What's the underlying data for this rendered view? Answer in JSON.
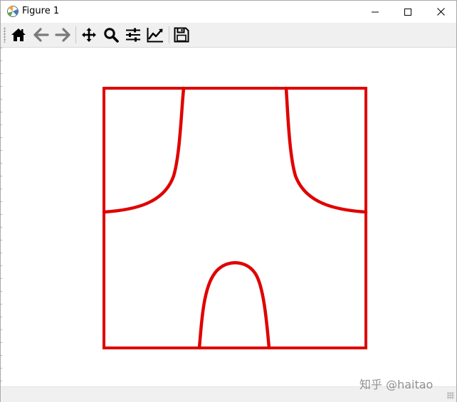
{
  "window": {
    "title": "Figure 1",
    "icons": {
      "app": "matplotlib-logo-icon",
      "minimize": "minimize-icon",
      "maximize": "maximize-icon",
      "close": "close-icon"
    }
  },
  "toolbar": {
    "buttons": [
      {
        "name": "home",
        "icon": "home-icon"
      },
      {
        "name": "back",
        "icon": "arrow-left-icon"
      },
      {
        "name": "forward",
        "icon": "arrow-right-icon"
      },
      {
        "name": "pan",
        "icon": "move-arrows-icon"
      },
      {
        "name": "zoom",
        "icon": "magnifier-icon"
      },
      {
        "name": "configure-subplots",
        "icon": "sliders-icon"
      },
      {
        "name": "edit-axes",
        "icon": "line-chart-icon"
      },
      {
        "name": "save",
        "icon": "floppy-disk-icon"
      }
    ]
  },
  "figure": {
    "line_color": "#e00000",
    "background": "#ffffff"
  },
  "watermark": {
    "text": "知乎 @haitao"
  }
}
